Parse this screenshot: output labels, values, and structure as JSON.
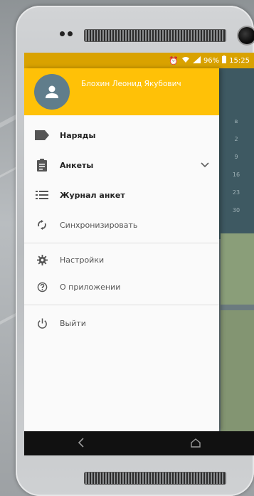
{
  "status_bar": {
    "battery_percent": "96%",
    "time": "15:25",
    "icons": [
      "alarm-icon",
      "wifi-icon",
      "signal-icon",
      "battery-icon"
    ]
  },
  "drawer": {
    "user_name": "Блохин Леонид Якубович",
    "items": [
      {
        "label": "Наряды",
        "icon": "label-icon"
      },
      {
        "label": "Анкеты",
        "icon": "clipboard-icon"
      },
      {
        "label": "Журнал анкет",
        "icon": "list-icon"
      },
      {
        "label": "Синхронизировать",
        "icon": "sync-icon"
      },
      {
        "label": "Настройки",
        "icon": "gear-icon"
      },
      {
        "label": "О приложении",
        "icon": "help-icon"
      },
      {
        "label": "Выйти",
        "icon": "power-icon"
      }
    ]
  },
  "background_app": {
    "calendar_values": [
      "в",
      "2",
      "9",
      "16",
      "23",
      "30"
    ]
  },
  "colors": {
    "accent": "#ffc107",
    "status_bar": "#d9a200",
    "avatar": "#607d8b"
  }
}
